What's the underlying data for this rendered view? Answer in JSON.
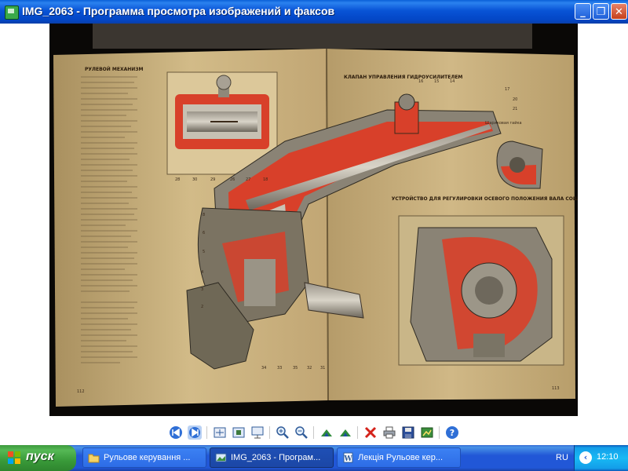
{
  "window": {
    "title": "IMG_2063 - Программа просмотра изображений и факсов",
    "buttons": {
      "minimize": "_",
      "maximize": "❐",
      "close": "✕"
    }
  },
  "photo": {
    "left_page_heading": "РУЛЕВОЙ МЕХАНИЗМ",
    "right_heading_valve": "КЛАПАН УПРАВЛЕНИЯ ГИДРОУСИЛИТЕЛЕМ",
    "right_heading_nut": "Шариковая гайка",
    "right_heading_adjust": "УСТРОЙСТВО ДЛЯ РЕГУЛИРОВКИ ОСЕВОГО ПОЛОЖЕНИЯ ВАЛА СОШКИ",
    "colors": {
      "page": "#cdb582",
      "red": "#d8402a",
      "metal": "#7f7868",
      "dark": "#3b3228"
    }
  },
  "toolbar": {
    "icons": [
      "previous-image-icon",
      "next-image-icon",
      "best-fit-icon",
      "actual-size-icon",
      "slideshow-icon",
      "zoom-in-icon",
      "zoom-out-icon",
      "rotate-clockwise-icon",
      "rotate-counterclockwise-icon",
      "delete-icon",
      "print-icon",
      "save-icon",
      "edit-icon",
      "help-icon"
    ]
  },
  "taskbar": {
    "start_label": "пуск",
    "tasks": [
      {
        "label": "Рульове керування ...",
        "icon": "folder-icon"
      },
      {
        "label": "IMG_2063 - Програм...",
        "icon": "image-viewer-icon"
      },
      {
        "label": "Лекція Рульове кер...",
        "icon": "word-document-icon"
      }
    ],
    "language": "RU",
    "clock": "12:10"
  }
}
